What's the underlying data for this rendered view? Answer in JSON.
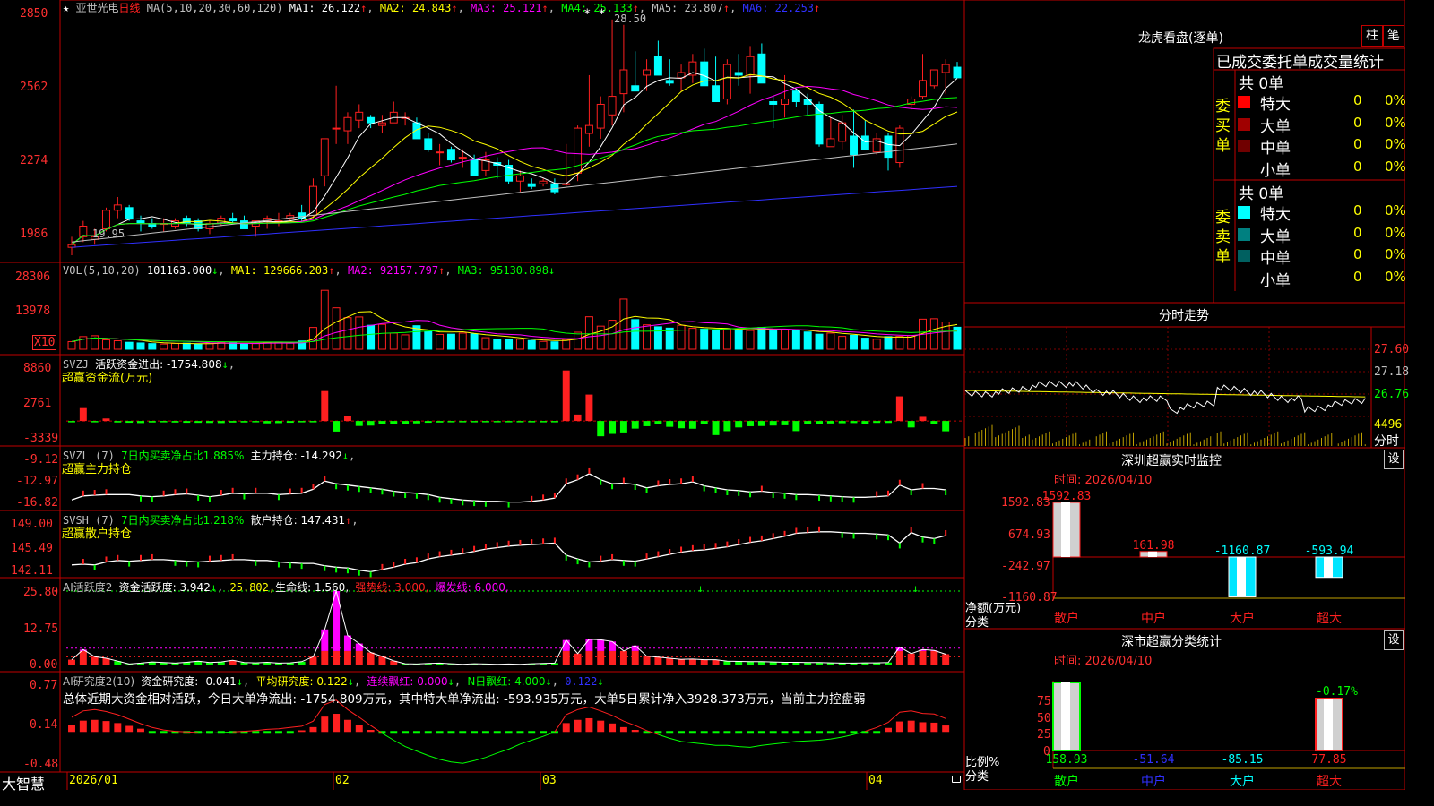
{
  "colors": {
    "up": "#ff2020",
    "down": "#00ffff",
    "grid": "#c00000",
    "axis": "#ff3030",
    "ma1": "#ffffff",
    "ma2": "#ffff00",
    "ma3": "#ff00ff",
    "ma4": "#00ff00",
    "ma5": "#c0c0c0",
    "ma6": "#3030ff",
    "gold": "#ffd700",
    "green": "#00ff00"
  },
  "footer": {
    "brand": "大智慧",
    "dates": [
      "2026/01",
      "02",
      "03",
      "04"
    ]
  },
  "main": {
    "title_star": "★",
    "stock": "亚世光电",
    "period": "日线",
    "ma_header": "MA(5,10,20,30,60,120)",
    "ma_items": [
      {
        "label": "MA1: 26.122",
        "arrow": "↑"
      },
      {
        "label": "MA2: 24.843",
        "arrow": "↑"
      },
      {
        "label": "MA3: 25.121",
        "arrow": "↑"
      },
      {
        "label": "MA4: 25.133",
        "arrow": "↑"
      },
      {
        "label": "MA5: 23.807",
        "arrow": "↑"
      },
      {
        "label": "MA6: 22.253",
        "arrow": "↑"
      }
    ],
    "y_ticks": [
      "2850",
      "2562",
      "2274",
      "1986"
    ],
    "hi_mark": "28.50",
    "lo_mark": "19.95",
    "flags": "**"
  },
  "vol": {
    "header": "VOL(5,10,20)",
    "value": "101163.000",
    "v_arrow": "↓",
    "items": [
      {
        "label": "MA1: 129666.203",
        "arrow": "↑"
      },
      {
        "label": "MA2: 92157.797",
        "arrow": "↑"
      },
      {
        "label": "MA3: 95130.898",
        "arrow": "↓"
      }
    ],
    "y_ticks": [
      "28306",
      "13978"
    ],
    "unit": "X10"
  },
  "svzj": {
    "header": "SVZJ",
    "label": "活跃资金进出: -1754.808",
    "arrow": "↓",
    "comma": ",",
    "sub": "超赢资金流(万元)",
    "y_ticks": [
      "8860",
      "2761",
      "-3339"
    ]
  },
  "svzl": {
    "header": "SVZL (7)",
    "green_text": "7日内买卖净占比1.885%",
    "label": "主力持仓: -14.292",
    "arrow": "↓",
    "comma": ",",
    "sub": "超赢主力持仓",
    "y_ticks": [
      "-9.12",
      "-12.97",
      "-16.82"
    ]
  },
  "svsh": {
    "header": "SVSH (7)",
    "green_text": "7日内买卖净占比1.218%",
    "label": "散户持仓: 147.431",
    "arrow": "↑",
    "comma": ",",
    "sub": "超赢散户持仓",
    "y_ticks": [
      "149.00",
      "145.49",
      "142.11"
    ]
  },
  "ai1": {
    "header": "AI活跃度2",
    "label": "资金活跃度: 3.942",
    "arrow": "↓",
    "v2": "25.802,",
    "v3": "生命线: 1.560,",
    "v4": "强势线: 3.000,",
    "v5": "爆发线: 6.000,",
    "y_ticks": [
      "25.80",
      "12.75",
      "0.00"
    ]
  },
  "ai2": {
    "header": "AI研究度2(10)",
    "label": "资金研究度: -0.041",
    "arrow": "↓",
    "v2": "平均研究度: 0.122",
    "a2": "↓",
    "v3": "连续飘红: 0.000",
    "a3": "↓",
    "v4": "N日飘红: 4.000",
    "v5": "0.122",
    "a5": "↓",
    "summary": "总体近期大资金相对活跃，今日大单净流出: -1754.809万元，其中特大单净流出: -593.935万元，大单5日累计净入3928.373万元，当前主力控盘弱",
    "y_ticks": [
      "0.77",
      "0.14",
      "-0.48"
    ]
  },
  "lhb": {
    "title": "龙虎看盘(逐单)",
    "btn1": "柱",
    "btn2": "笔",
    "headline": "已成交委托单成交量统计",
    "buy_label": "委买单",
    "sell_label": "委卖单",
    "buy_total": "共 0单",
    "sell_total": "共 0单",
    "buy_rows": [
      {
        "name": "特大",
        "val": "0",
        "pct": "0%",
        "color": "#ff0000"
      },
      {
        "name": "大单",
        "val": "0",
        "pct": "0%",
        "color": "#a00000"
      },
      {
        "name": "中单",
        "val": "0",
        "pct": "0%",
        "color": "#700000"
      },
      {
        "name": "小单",
        "val": "0",
        "pct": "0%",
        "color": ""
      }
    ],
    "sell_rows": [
      {
        "name": "特大",
        "val": "0",
        "pct": "0%",
        "color": "#00ffff"
      },
      {
        "name": "大单",
        "val": "0",
        "pct": "0%",
        "color": "#008080"
      },
      {
        "name": "中单",
        "val": "0",
        "pct": "0%",
        "color": "#006060"
      },
      {
        "name": "小单",
        "val": "0",
        "pct": "0%",
        "color": ""
      }
    ]
  },
  "intraday": {
    "title": "分时走势",
    "y_ticks": [
      "27.60",
      "27.18",
      "26.76",
      "4496",
      "分时"
    ]
  },
  "monitor": {
    "title": "深圳超赢实时监控",
    "set": "设",
    "time": "时间: 2026/04/10",
    "y_ticks": [
      "1592.83",
      "674.93",
      "-242.97",
      "-1160.87"
    ],
    "ylabel1": "净额(万元)",
    "ylabel2": "分类",
    "categories": [
      "散户",
      "中户",
      "大户",
      "超大"
    ],
    "values": [
      "1592.83",
      "161.98",
      "-1160.87",
      "-593.94"
    ]
  },
  "classify": {
    "title": "深市超赢分类统计",
    "set": "设",
    "time": "时间: 2026/04/10",
    "y_ticks": [
      "75",
      "50",
      "25",
      "0"
    ],
    "ylabel1": "比例%",
    "ylabel2": "分类",
    "categories": [
      "散户",
      "中户",
      "大户",
      "超大"
    ],
    "values": [
      "158.93",
      "-51.64",
      "-85.15",
      "77.85"
    ],
    "top_label": "-0.17%"
  },
  "chart_data": [
    {
      "type": "candlestick",
      "title": "亚世光电 日线",
      "ylim": [
        19.5,
        28.9
      ],
      "y_ticks": [
        "2850",
        "2562",
        "2274",
        "1986"
      ],
      "ohlc": [
        [
          19.9,
          20.3,
          19.6,
          20.0
        ],
        [
          20.3,
          20.9,
          20.1,
          20.7
        ],
        [
          20.2,
          20.6,
          20.0,
          20.3
        ],
        [
          20.6,
          21.4,
          20.5,
          21.3
        ],
        [
          21.3,
          21.8,
          21.0,
          21.5
        ],
        [
          21.4,
          21.5,
          20.9,
          21.0
        ],
        [
          20.9,
          21.1,
          20.5,
          20.8
        ],
        [
          20.8,
          21.0,
          20.6,
          20.7
        ],
        [
          20.8,
          21.0,
          20.5,
          20.8
        ],
        [
          20.7,
          21.0,
          20.6,
          20.9
        ],
        [
          21.0,
          21.1,
          20.7,
          20.8
        ],
        [
          20.9,
          21.0,
          20.5,
          20.6
        ],
        [
          20.6,
          20.9,
          20.4,
          20.8
        ],
        [
          20.8,
          21.1,
          20.7,
          21.0
        ],
        [
          21.0,
          21.2,
          20.8,
          20.9
        ],
        [
          20.9,
          21.1,
          20.6,
          20.6
        ],
        [
          20.7,
          20.9,
          20.3,
          20.9
        ],
        [
          20.9,
          21.1,
          20.6,
          21.0
        ],
        [
          20.9,
          21.2,
          20.7,
          20.9
        ],
        [
          21.0,
          21.2,
          20.9,
          21.1
        ],
        [
          21.2,
          21.5,
          20.9,
          21.0
        ],
        [
          21.1,
          22.5,
          21.0,
          22.2
        ],
        [
          22.6,
          24.0,
          22.2,
          24.0
        ],
        [
          24.4,
          26.0,
          23.8,
          24.4
        ],
        [
          24.3,
          25.0,
          23.8,
          24.8
        ],
        [
          24.7,
          25.3,
          24.4,
          25.0
        ],
        [
          24.8,
          24.9,
          24.4,
          24.6
        ],
        [
          24.5,
          24.9,
          24.2,
          24.6
        ],
        [
          24.6,
          25.4,
          24.6,
          25.0
        ],
        [
          24.8,
          25.0,
          24.5,
          24.8
        ],
        [
          24.6,
          24.8,
          24.0,
          24.0
        ],
        [
          24.0,
          24.2,
          23.5,
          23.6
        ],
        [
          23.5,
          23.8,
          23.0,
          23.5
        ],
        [
          23.6,
          23.7,
          23.1,
          23.2
        ],
        [
          23.3,
          23.6,
          22.9,
          23.3
        ],
        [
          23.2,
          23.4,
          22.6,
          22.6
        ],
        [
          22.8,
          23.5,
          22.6,
          23.2
        ],
        [
          23.1,
          23.3,
          22.5,
          23.0
        ],
        [
          23.0,
          23.2,
          22.3,
          22.4
        ],
        [
          22.4,
          22.8,
          22.0,
          22.6
        ],
        [
          22.3,
          22.5,
          22.1,
          22.2
        ],
        [
          22.3,
          22.5,
          22.2,
          22.4
        ],
        [
          22.3,
          22.5,
          21.9,
          22.0
        ],
        [
          22.3,
          23.8,
          22.2,
          22.3
        ],
        [
          22.7,
          24.5,
          22.4,
          24.4
        ],
        [
          24.2,
          26.4,
          23.7,
          24.5
        ],
        [
          24.4,
          25.6,
          24.0,
          25.3
        ],
        [
          24.9,
          28.5,
          24.5,
          25.6
        ],
        [
          25.7,
          28.3,
          25.0,
          26.6
        ],
        [
          26.0,
          27.3,
          25.9,
          25.8
        ],
        [
          26.4,
          27.0,
          25.8,
          26.6
        ],
        [
          27.1,
          27.7,
          26.4,
          26.4
        ],
        [
          26.2,
          27.0,
          26.0,
          26.1
        ],
        [
          26.3,
          26.8,
          25.8,
          26.5
        ],
        [
          26.4,
          27.2,
          26.1,
          26.9
        ],
        [
          26.9,
          27.4,
          26.4,
          26.0
        ],
        [
          26.0,
          27.1,
          25.4,
          25.4
        ],
        [
          25.5,
          27.0,
          25.3,
          26.8
        ],
        [
          26.5,
          27.2,
          26.0,
          26.4
        ],
        [
          26.4,
          27.5,
          25.7,
          27.1
        ],
        [
          27.2,
          27.6,
          26.1,
          26.1
        ],
        [
          25.4,
          25.6,
          24.4,
          25.3
        ],
        [
          25.3,
          26.4,
          24.8,
          25.5
        ],
        [
          25.8,
          25.9,
          25.2,
          25.4
        ],
        [
          25.5,
          25.7,
          24.9,
          25.3
        ],
        [
          25.3,
          25.4,
          23.7,
          23.8
        ],
        [
          23.7,
          24.8,
          23.7,
          24.0
        ],
        [
          23.9,
          24.9,
          23.6,
          24.6
        ],
        [
          24.1,
          25.1,
          22.9,
          23.4
        ],
        [
          24.1,
          24.7,
          23.6,
          23.6
        ],
        [
          23.5,
          24.2,
          23.4,
          24.0
        ],
        [
          24.1,
          24.2,
          22.8,
          23.3
        ],
        [
          23.1,
          24.5,
          22.9,
          24.4
        ],
        [
          25.3,
          25.6,
          25.1,
          25.5
        ],
        [
          25.6,
          27.2,
          25.5,
          26.2
        ],
        [
          26.0,
          26.6,
          25.9,
          26.6
        ],
        [
          26.5,
          27.0,
          25.7,
          26.8
        ],
        [
          26.7,
          26.9,
          26.3,
          26.3
        ]
      ]
    },
    {
      "type": "bar",
      "title": "VOL(5,10,20)",
      "ylim": [
        0,
        32000
      ],
      "values": [
        3500,
        5800,
        6200,
        4300,
        3900,
        3200,
        2900,
        2600,
        2400,
        2700,
        2800,
        2500,
        2600,
        3100,
        3000,
        2500,
        2600,
        3100,
        3300,
        2800,
        3800,
        10000,
        27000,
        19000,
        14500,
        14800,
        11000,
        11400,
        7400,
        6600,
        10800,
        8200,
        6800,
        6900,
        7400,
        7000,
        5300,
        4700,
        4500,
        4600,
        4000,
        3600,
        3400,
        4500,
        7800,
        14900,
        10600,
        13300,
        23000,
        13600,
        11200,
        10300,
        9700,
        11000,
        9600,
        9300,
        8800,
        9300,
        8900,
        8600,
        10000,
        8400,
        8900,
        8500,
        7900,
        6900,
        7400,
        5900,
        6400,
        5100,
        4600,
        5800,
        5900,
        6300,
        13800,
        14000,
        12500,
        10100
      ]
    },
    {
      "type": "bar",
      "title": "SVZJ 活跃资金进出",
      "ylim": [
        -3339,
        8860
      ],
      "values": [
        -150,
        2200,
        -200,
        430,
        -250,
        -300,
        -350,
        -250,
        -200,
        -260,
        -300,
        -310,
        -330,
        -350,
        -260,
        -250,
        -200,
        -400,
        -360,
        -300,
        -200,
        -100,
        5100,
        -1800,
        920,
        -850,
        -790,
        -560,
        -470,
        -530,
        -410,
        -300,
        -260,
        -220,
        -200,
        -180,
        -160,
        -150,
        -140,
        -100,
        -120,
        -150,
        -200,
        8600,
        1100,
        4500,
        -2600,
        -2200,
        -1950,
        -1300,
        -890,
        -560,
        -1000,
        -1240,
        -1320,
        -520,
        -2400,
        -1730,
        -1100,
        -890,
        -860,
        -780,
        -730,
        -1720,
        -520,
        -480,
        -420,
        -380,
        -350,
        -500,
        -320,
        -330,
        4200,
        -1100,
        710,
        -560,
        -1750
      ]
    },
    {
      "type": "line",
      "title": "SVZL 主力持仓",
      "ylim": [
        -16.82,
        -9.12
      ],
      "values": [
        -15.8,
        -15.2,
        -15.1,
        -15.0,
        -15.0,
        -15.0,
        -15.2,
        -15.3,
        -15.2,
        -15.0,
        -14.9,
        -15.1,
        -15.3,
        -15.1,
        -14.8,
        -14.9,
        -14.8,
        -14.8,
        -15.0,
        -14.9,
        -14.8,
        -14.2,
        -13.0,
        -13.4,
        -13.6,
        -13.8,
        -14.0,
        -14.2,
        -14.5,
        -14.7,
        -14.8,
        -15.0,
        -15.4,
        -15.6,
        -15.8,
        -15.9,
        -16.0,
        -16.0,
        -16.1,
        -16.1,
        -16.0,
        -15.8,
        -15.5,
        -13.4,
        -12.8,
        -11.9,
        -12.8,
        -13.4,
        -13.3,
        -13.5,
        -14.0,
        -13.7,
        -13.5,
        -13.4,
        -13.1,
        -13.7,
        -14.0,
        -14.3,
        -14.4,
        -14.6,
        -14.5,
        -14.7,
        -14.8,
        -15.0,
        -15.0,
        -15.1,
        -15.2,
        -15.3,
        -15.4,
        -15.4,
        -15.3,
        -15.2,
        -13.6,
        -14.3,
        -14.1,
        -14.1,
        -14.3
      ]
    },
    {
      "type": "line",
      "title": "SVSH 散户持仓",
      "ylim": [
        142.11,
        149.0
      ],
      "values": [
        143.2,
        143.3,
        143.2,
        143.6,
        143.8,
        143.7,
        143.8,
        143.9,
        143.9,
        143.8,
        143.7,
        143.6,
        143.7,
        143.8,
        143.9,
        143.9,
        143.8,
        143.8,
        143.6,
        143.5,
        143.4,
        143.4,
        143.1,
        142.9,
        142.8,
        142.5,
        142.3,
        142.6,
        142.9,
        143.3,
        143.5,
        144.0,
        144.3,
        144.5,
        144.7,
        145.0,
        145.3,
        145.5,
        145.7,
        145.8,
        145.9,
        146.0,
        146.1,
        144.5,
        144.0,
        143.6,
        143.7,
        143.9,
        143.8,
        143.7,
        144.0,
        144.3,
        144.6,
        144.9,
        145.1,
        145.2,
        145.4,
        145.6,
        145.9,
        146.2,
        146.4,
        146.7,
        147.0,
        147.4,
        147.5,
        147.6,
        147.6,
        147.5,
        147.4,
        147.4,
        147.3,
        147.2,
        146.1,
        147.5,
        146.9,
        146.7,
        147.1
      ]
    },
    {
      "type": "bar",
      "title": "AI活跃度2",
      "ylim": [
        0,
        25.8
      ],
      "values": [
        2.0,
        5.5,
        3.0,
        2.5,
        1.5,
        0.5,
        0.8,
        1.2,
        1.0,
        0.8,
        1.1,
        1.5,
        1.0,
        1.2,
        1.8,
        1.0,
        0.9,
        1.1,
        0.8,
        0.9,
        1.3,
        3.0,
        12.5,
        25.8,
        10.4,
        7.6,
        4.5,
        3.1,
        1.6,
        0.6,
        0.5,
        0.7,
        0.8,
        0.6,
        0.4,
        0.6,
        0.5,
        0.4,
        0.5,
        0.4,
        0.6,
        0.7,
        0.8,
        8.8,
        4.1,
        9.1,
        8.9,
        8.3,
        5.0,
        6.9,
        3.2,
        2.9,
        2.5,
        2.1,
        2.2,
        2.0,
        2.0,
        1.5,
        1.4,
        1.3,
        1.3,
        1.2,
        1.1,
        1.1,
        1.0,
        1.0,
        0.9,
        0.8,
        0.8,
        0.9,
        0.9,
        1.0,
        6.4,
        4.1,
        5.5,
        5.2,
        3.9
      ]
    },
    {
      "type": "line",
      "title": "AI研究度2(10)",
      "ylim": [
        -0.48,
        0.77
      ],
      "values": [
        0.28,
        0.38,
        0.4,
        0.37,
        0.32,
        0.25,
        0.18,
        0.12,
        0.08,
        0.06,
        0.05,
        0.04,
        0.03,
        0.04,
        0.05,
        0.06,
        0.07,
        0.09,
        0.1,
        0.12,
        0.14,
        0.22,
        0.48,
        0.55,
        0.4,
        0.28,
        0.15,
        0.03,
        -0.08,
        -0.18,
        -0.25,
        -0.32,
        -0.38,
        -0.42,
        -0.44,
        -0.4,
        -0.35,
        -0.28,
        -0.22,
        -0.14,
        -0.08,
        -0.02,
        0.05,
        0.32,
        0.4,
        0.44,
        0.38,
        0.31,
        0.22,
        0.15,
        0.07,
        0.01,
        -0.05,
        -0.1,
        -0.12,
        -0.14,
        -0.16,
        -0.16,
        -0.18,
        -0.19,
        -0.16,
        -0.14,
        -0.12,
        -0.1,
        -0.09,
        -0.08,
        -0.06,
        -0.03,
        0.01,
        0.06,
        0.12,
        0.2,
        0.36,
        0.38,
        0.34,
        0.33,
        0.26
      ]
    }
  ]
}
